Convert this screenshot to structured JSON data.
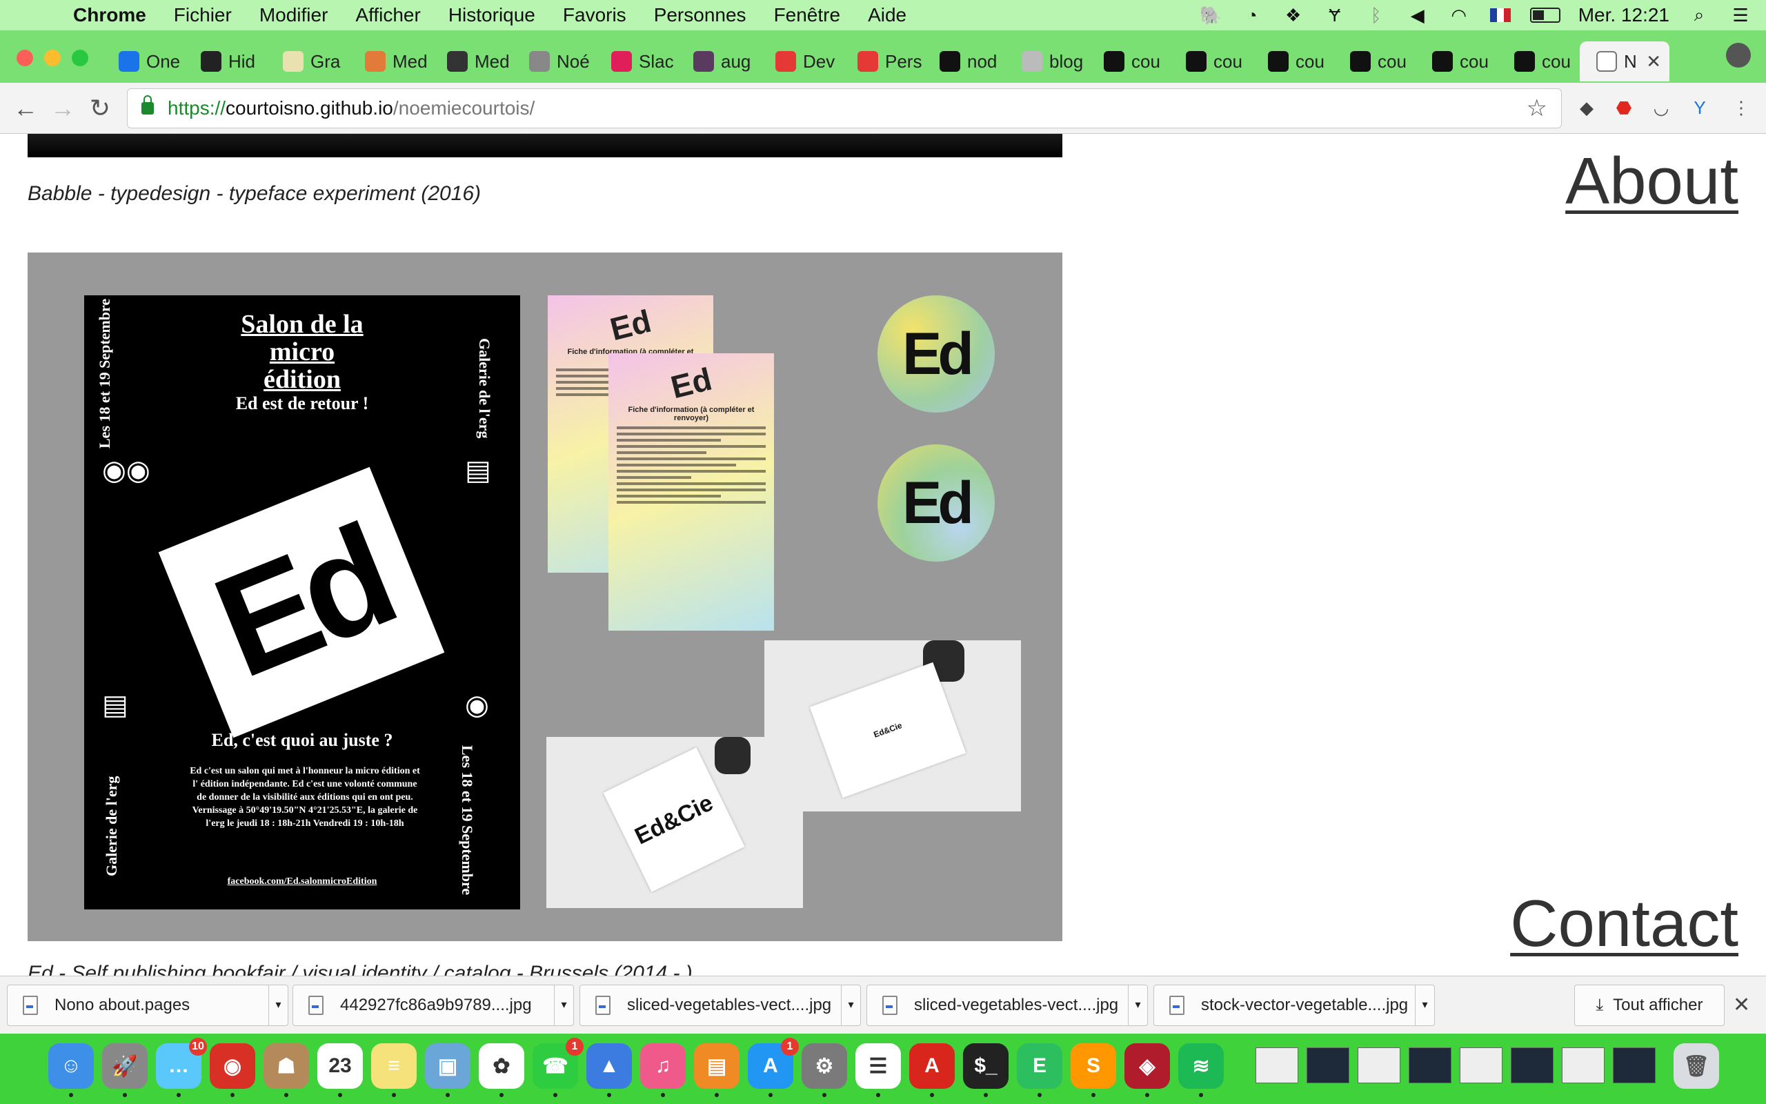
{
  "menubar": {
    "apple": "",
    "app_name": "Chrome",
    "menus": [
      "Fichier",
      "Modifier",
      "Afficher",
      "Historique",
      "Favoris",
      "Personnes",
      "Fenêtre",
      "Aide"
    ],
    "clock": "Mer. 12:21"
  },
  "tabs": [
    {
      "label": "One",
      "icon": "y-icon",
      "color": "#1a73e8"
    },
    {
      "label": "Hid",
      "icon": "hidden-icon",
      "color": "#222222"
    },
    {
      "label": "Gra",
      "icon": "grammar-icon",
      "color": "#e9e2b0"
    },
    {
      "label": "Med",
      "icon": "medium-icon",
      "color": "#e27b3a"
    },
    {
      "label": "Med",
      "icon": "webflow-icon",
      "color": "#333333"
    },
    {
      "label": "Noé",
      "icon": "peace-icon",
      "color": "#888888"
    },
    {
      "label": "Slac",
      "icon": "slack-icon",
      "color": "#e01e5a"
    },
    {
      "label": "aug",
      "icon": "hash-icon",
      "color": "#5b3a60"
    },
    {
      "label": "Dev",
      "icon": "gear-red-icon",
      "color": "#e53935"
    },
    {
      "label": "Pers",
      "icon": "gear-red-icon",
      "color": "#e53935"
    },
    {
      "label": "nod",
      "icon": "github-icon",
      "color": "#111111"
    },
    {
      "label": "blog",
      "icon": "page-icon",
      "color": "#bbbbbb"
    },
    {
      "label": "cou",
      "icon": "github-icon",
      "color": "#111111"
    },
    {
      "label": "cou",
      "icon": "github-icon",
      "color": "#111111"
    },
    {
      "label": "cou",
      "icon": "github-icon",
      "color": "#111111"
    },
    {
      "label": "cou",
      "icon": "github-icon",
      "color": "#111111"
    },
    {
      "label": "cou",
      "icon": "github-icon",
      "color": "#111111"
    },
    {
      "label": "cou",
      "icon": "github-icon",
      "color": "#111111"
    }
  ],
  "active_tab": {
    "label": "N"
  },
  "address": {
    "scheme": "https://",
    "host": "courtoisno.github.io",
    "path": "/noemiecourtois/"
  },
  "page": {
    "caption_top": "Babble - typedesign - typeface experiment (2016)",
    "nav_about": "About",
    "nav_contact": "Contact",
    "caption_bottom": "Ed - Self publishing bookfair / visual identity / catalog - Brussels (2014 - )",
    "poster": {
      "title": "Salon de la micro édition",
      "subtitle": "Ed est de retour !",
      "logo": "Ed",
      "question": "Ed, c'est quoi au juste ?",
      "body": "Ed c'est un salon qui met à l'honneur la micro édition et l' édition indépendante. Ed c'est une volonté commune de donner de la visibilité aux éditions qui en ont peu. Vernissage à 50°49'19.50\"N 4°21'25.53\"E, la galerie de l'erg le jeudi 18 : 18h-21h Vendredi 19 : 10h-18h",
      "link": "facebook.com/Ed.salonmicroEdition",
      "side_dates": "Les 18 et 19 Septembre",
      "side_place": "Galerie de l'erg",
      "side_coords": "50°49'19.50\"N 4°21'25.53\"E"
    },
    "flyer_title": "Fiche d'information (à compléter et renvoyer)",
    "sticker": "Ed",
    "card_text": "Ed&Cie"
  },
  "downloads": {
    "items": [
      "Nono about.pages",
      "442927fc86a9b9789....jpg",
      "sliced-vegetables-vect....jpg",
      "sliced-vegetables-vect....jpg",
      "stock-vector-vegetable....jpg"
    ],
    "show_all": "Tout afficher"
  },
  "dock": {
    "items": [
      {
        "name": "finder",
        "color": "#3d8fe8",
        "glyph": "☺"
      },
      {
        "name": "launchpad",
        "color": "#888888",
        "glyph": "🚀"
      },
      {
        "name": "messages",
        "color": "#5ac8fa",
        "glyph": "…",
        "badge": "10"
      },
      {
        "name": "chrome",
        "color": "#d93025",
        "glyph": "◉"
      },
      {
        "name": "contacts",
        "color": "#b58a5a",
        "glyph": "☗"
      },
      {
        "name": "calendar",
        "color": "#ffffff",
        "glyph": "23"
      },
      {
        "name": "notes",
        "color": "#f5e27a",
        "glyph": "≡"
      },
      {
        "name": "preview",
        "color": "#6aa6d8",
        "glyph": "▣"
      },
      {
        "name": "photos",
        "color": "#ffffff",
        "glyph": "✿"
      },
      {
        "name": "facetime",
        "color": "#2ecc40",
        "glyph": "☎",
        "badge": "1"
      },
      {
        "name": "keynote",
        "color": "#3c7be0",
        "glyph": "▲"
      },
      {
        "name": "itunes",
        "color": "#f05a8a",
        "glyph": "♫"
      },
      {
        "name": "ibooks",
        "color": "#f08a24",
        "glyph": "▤"
      },
      {
        "name": "appstore",
        "color": "#2196f3",
        "glyph": "A",
        "badge": "1"
      },
      {
        "name": "system-preferences",
        "color": "#7a7a7a",
        "glyph": "⚙"
      },
      {
        "name": "reminders",
        "color": "#ffffff",
        "glyph": "☰"
      },
      {
        "name": "acrobat",
        "color": "#d8261d",
        "glyph": "A"
      },
      {
        "name": "terminal",
        "color": "#222222",
        "glyph": "$_"
      },
      {
        "name": "evernote",
        "color": "#2dbe60",
        "glyph": "E"
      },
      {
        "name": "sublime",
        "color": "#ff9800",
        "glyph": "S"
      },
      {
        "name": "mendeley",
        "color": "#b01c2c",
        "glyph": "◈"
      },
      {
        "name": "spotify",
        "color": "#1db954",
        "glyph": "≋"
      }
    ]
  }
}
